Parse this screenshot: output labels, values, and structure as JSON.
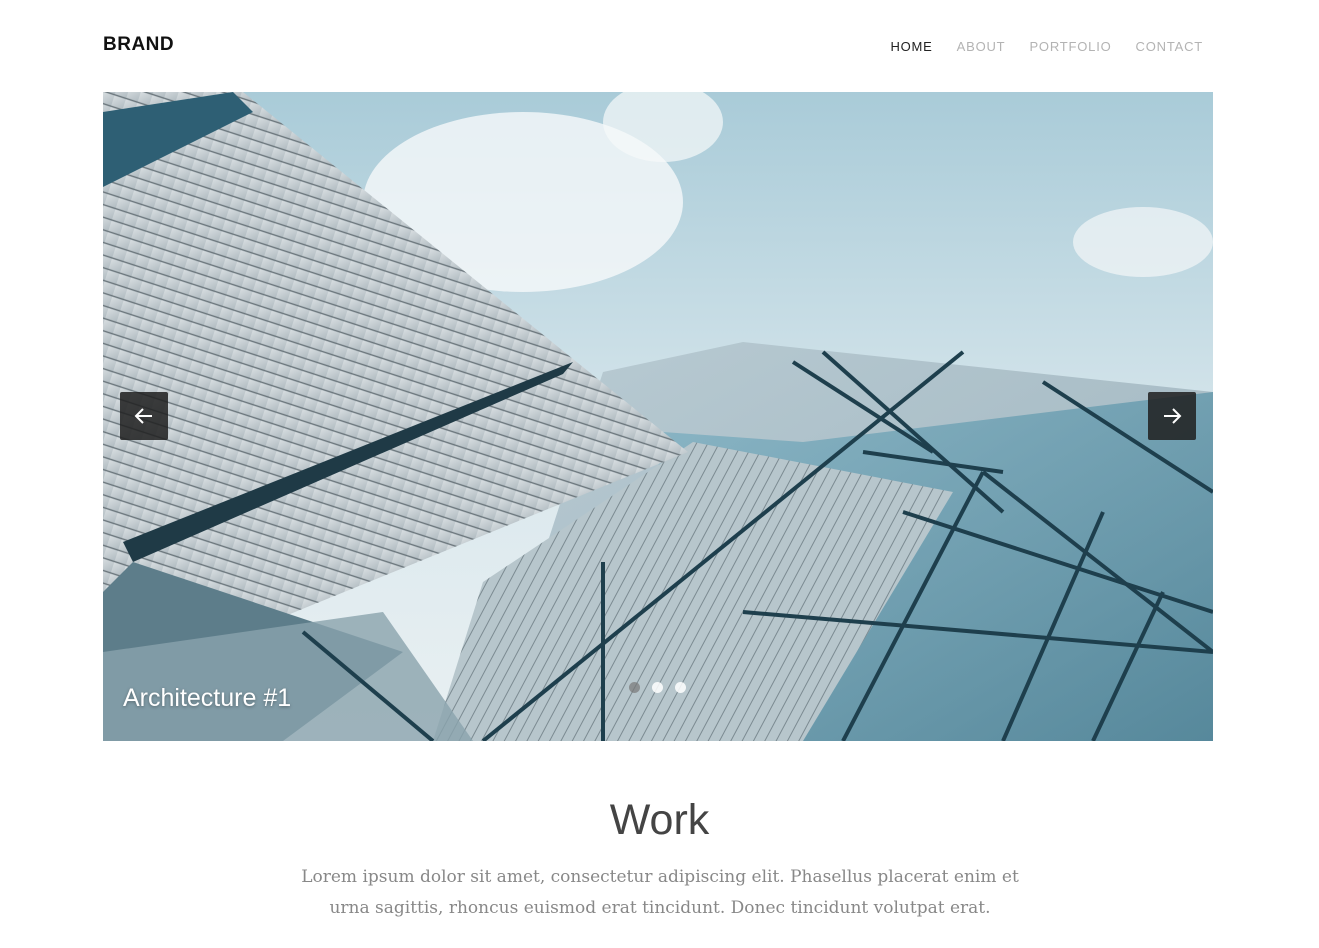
{
  "header": {
    "brand": "BRAND",
    "nav": [
      {
        "label": "HOME",
        "active": true
      },
      {
        "label": "ABOUT",
        "active": false
      },
      {
        "label": "PORTFOLIO",
        "active": false
      },
      {
        "label": "CONTACT",
        "active": false
      }
    ]
  },
  "slider": {
    "caption": "Architecture #1",
    "prev_icon": "arrow-left-icon",
    "next_icon": "arrow-right-icon",
    "slide_count": 3,
    "active_slide": 1
  },
  "section": {
    "title": "Work",
    "text": "Lorem ipsum dolor sit amet, consectetur adipiscing elit. Phasellus placerat enim et urna sagittis, rhoncus euismod erat tincidunt. Donec tincidunt volutpat erat."
  },
  "colors": {
    "text_dark": "#222222",
    "nav_inactive": "#b3b3b3",
    "arrow_bg": "#1e1e1e"
  }
}
